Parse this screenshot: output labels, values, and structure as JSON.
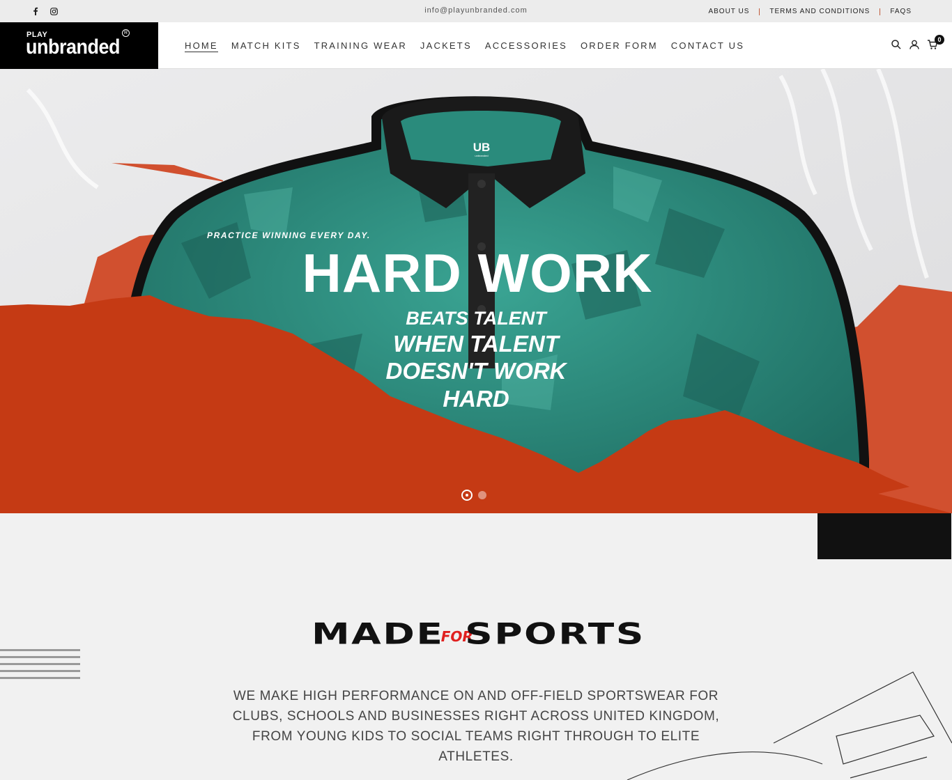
{
  "topbar": {
    "social": [
      {
        "name": "facebook-icon",
        "glyph": "f"
      },
      {
        "name": "instagram-icon",
        "glyph": "◎"
      }
    ],
    "email": "info@playunbranded.com",
    "links": [
      "ABOUT US",
      "TERMS AND CONDITIONS",
      "FAQS"
    ]
  },
  "header": {
    "logo": {
      "play": "PLAY",
      "brand": "unbranded",
      "reg": "R"
    },
    "nav": [
      "HOME",
      "MATCH KITS",
      "TRAINING WEAR",
      "JACKETS",
      "ACCESSORIES",
      "ORDER FORM",
      "CONTACT US"
    ],
    "active_nav": "HOME",
    "tools": [
      "search-icon",
      "user-icon",
      "cart-icon"
    ],
    "cart_count": "0"
  },
  "hero": {
    "kicker": "PRACTICE WINNING EVERY DAY.",
    "headline": "HARD WORK",
    "sub": [
      "BEATS TALENT",
      "WHEN TALENT",
      "DOESN'T WORK",
      "HARD"
    ],
    "shirt_logo": "UB",
    "shirt_logo_sub": "unbranded",
    "slides": 2,
    "active_slide": 1,
    "colors": {
      "accent": "#c53a14",
      "shirt": "#2f8f80"
    }
  },
  "section": {
    "title_left": "MADE",
    "title_for": "FOR",
    "title_right": "SPORTS",
    "description": "WE MAKE HIGH PERFORMANCE ON AND OFF-FIELD SPORTSWEAR FOR CLUBS, SCHOOLS AND BUSINESSES RIGHT ACROSS UNITED KINGDOM, FROM YOUNG KIDS TO SOCIAL TEAMS RIGHT THROUGH TO ELITE ATHLETES."
  }
}
